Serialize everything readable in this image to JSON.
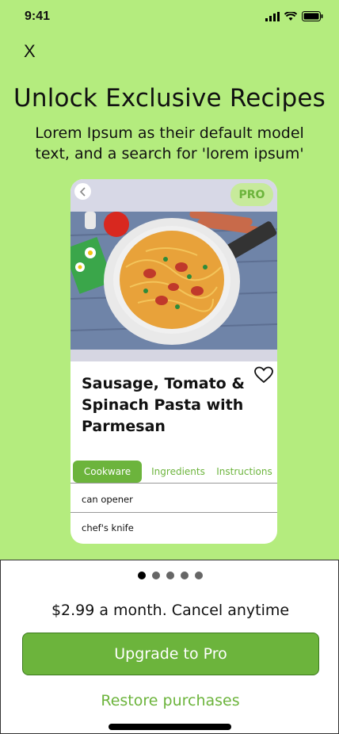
{
  "status": {
    "time": "9:41"
  },
  "header": {
    "close_label": "X"
  },
  "hero": {
    "title": "Unlock Exclusive Recipes",
    "subtitle": "Lorem Ipsum as their default model text, and a search for 'lorem ipsum'"
  },
  "card": {
    "badge": "PRO",
    "recipe_title": "Sausage, Tomato & Spinach Pasta with Parmesan",
    "tabs": [
      {
        "label": "Cookware",
        "active": true
      },
      {
        "label": "Ingredients",
        "active": false
      },
      {
        "label": "Instructions",
        "active": false
      }
    ],
    "items": [
      "can opener",
      "chef's knife"
    ]
  },
  "pager": {
    "count": 5,
    "active_index": 0
  },
  "sheet": {
    "price": "$2.99 a month. Cancel anytime",
    "upgrade_label": "Upgrade to Pro",
    "restore_label": "Restore purchases"
  },
  "colors": {
    "background": "#b4ec7e",
    "accent": "#6cb43c"
  }
}
